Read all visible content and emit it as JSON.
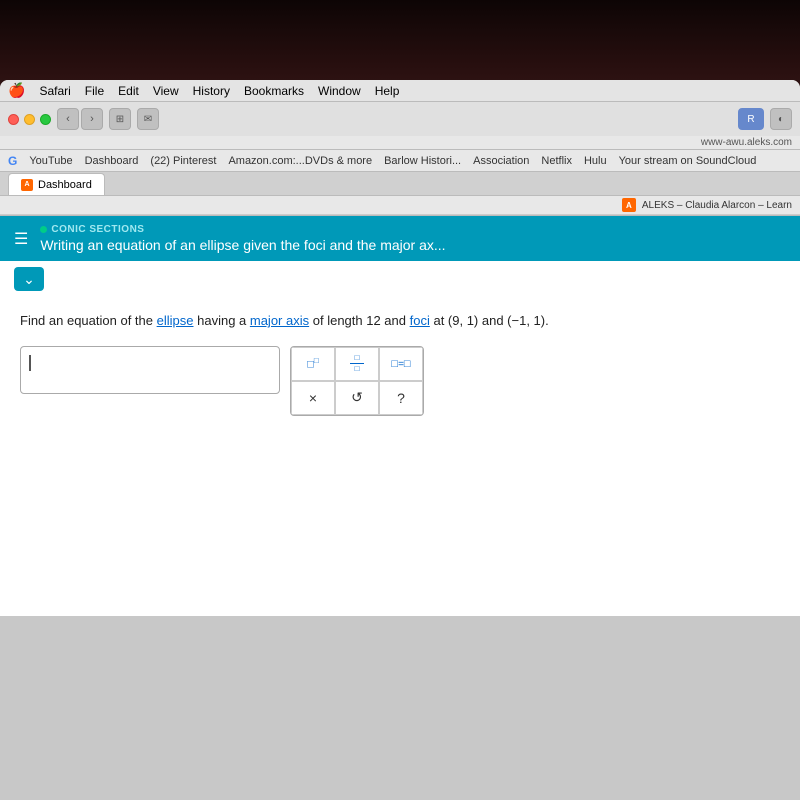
{
  "desktop": {
    "bg_color": "#1a0808"
  },
  "menubar": {
    "apple": "🍎",
    "items": [
      "Safari",
      "File",
      "Edit",
      "View",
      "History",
      "Bookmarks",
      "Window",
      "Help"
    ]
  },
  "browser": {
    "url": "www-awu.aleks.com",
    "tab_title": "Dashboard",
    "bookmarks": [
      "Google",
      "YouTube",
      "Dashboard",
      "(22) Pinterest",
      "Amazon.com:...DVDs & more",
      "Barlow Histori...",
      "Association",
      "Netflix",
      "Hulu",
      "Your stream on SoundCloud"
    ],
    "aleks_bar": "ALEKS – Claudia Alarcon – Learn"
  },
  "aleks": {
    "section_label": "CONIC SECTIONS",
    "topic_title": "Writing an equation of an ellipse given the foci and the major ax...",
    "problem_text_1": "Find an equation of the",
    "ellipse_link": "ellipse",
    "problem_text_2": "having a",
    "major_axis_link": "major axis",
    "problem_text_3": "of length 12 and",
    "foci_link": "foci",
    "problem_text_4": "at (9, 1) and (−1, 1).",
    "keyboard": {
      "row1": [
        "□²",
        "□/□",
        "□=□"
      ],
      "row2": [
        "×",
        "↺",
        "?"
      ]
    }
  }
}
